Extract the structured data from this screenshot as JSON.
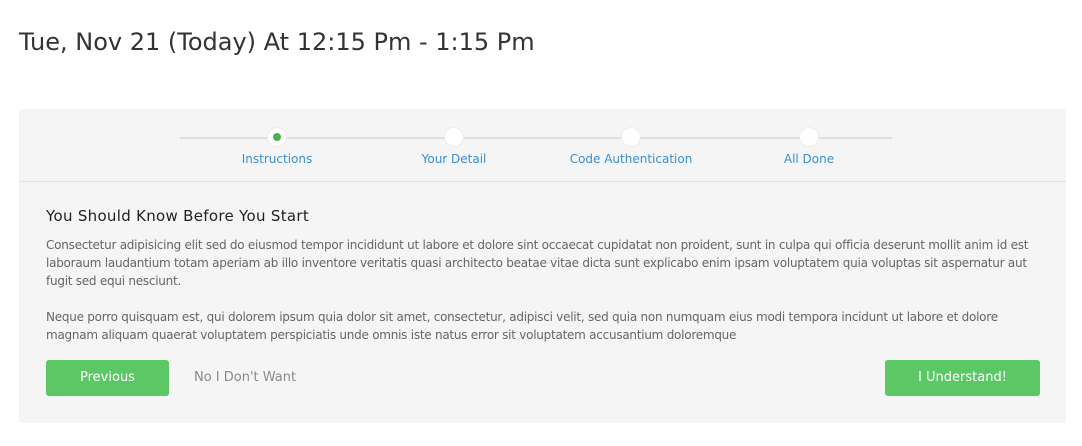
{
  "header": {
    "title": "Tue, Nov 21 (Today) At 12:15 Pm - 1:15 Pm"
  },
  "steps": [
    {
      "label": "Instructions",
      "active": true
    },
    {
      "label": "Your Detail",
      "active": false
    },
    {
      "label": "Code Authentication",
      "active": false
    },
    {
      "label": "All Done",
      "active": false
    }
  ],
  "content": {
    "heading": "You Should Know Before You Start",
    "paragraph1": "Consectetur adipisicing elit sed do eiusmod tempor incididunt ut labore et dolore sint occaecat cupidatat non proident, sunt in culpa qui officia deserunt mollit anim id est laboraum laudantium totam aperiam ab illo inventore veritatis quasi architecto beatae vitae dicta sunt explicabo enim ipsam voluptatem quia voluptas sit aspernatur aut fugit sed equi nesciunt.",
    "paragraph2": "Neque porro quisquam est, qui dolorem ipsum quia dolor sit amet, consectetur, adipisci velit, sed quia non numquam eius modi tempora incidunt ut labore et dolore magnam aliquam quaerat voluptatem perspiciatis unde omnis iste natus error sit voluptatem accusantium doloremque"
  },
  "actions": {
    "previous_label": "Previous",
    "decline_label": "No I Don't Want",
    "accept_label": "I Understand!"
  },
  "colors": {
    "accent_green": "#5bc765",
    "active_step_dot": "#4cb050",
    "step_label_blue": "#3a8fd3",
    "card_background": "#f5f5f5"
  }
}
